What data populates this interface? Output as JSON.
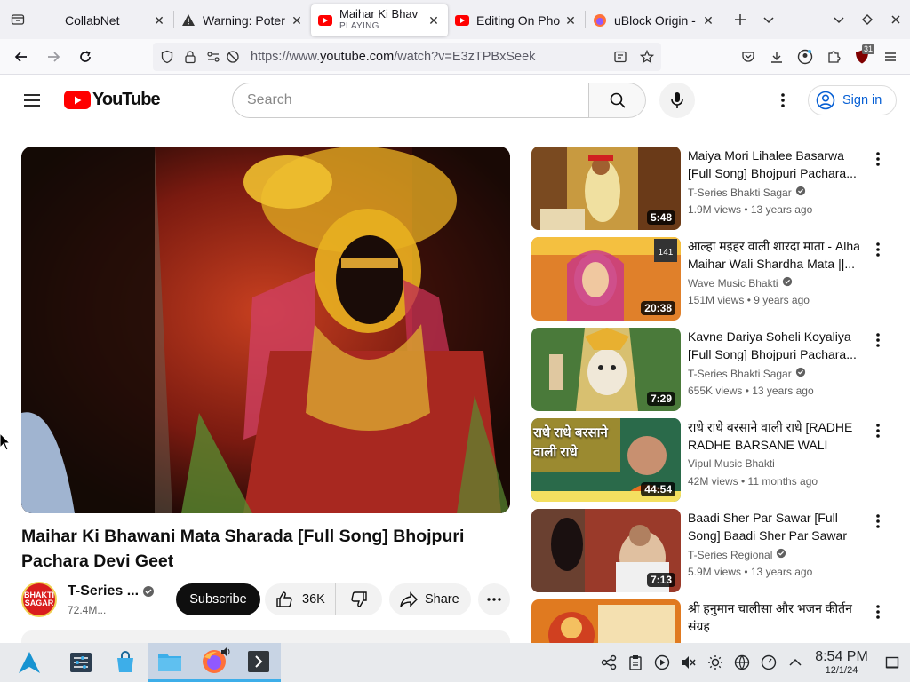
{
  "browser": {
    "tabs": [
      {
        "title": "CollabNet",
        "favicon": "blank-page-icon"
      },
      {
        "title": "Warning: Poter",
        "favicon": "warning-icon"
      },
      {
        "title": "Maihar Ki Bhav",
        "sub": "PLAYING",
        "favicon": "youtube-icon",
        "active": true
      },
      {
        "title": "Editing On Pho",
        "favicon": "youtube-icon"
      },
      {
        "title": "uBlock Origin -",
        "favicon": "firefox-icon"
      }
    ],
    "url_prefix": "https://www.",
    "url_host": "youtube.com",
    "url_path": "/watch?v=E3zTPBxSeek",
    "ublock_badge": "31"
  },
  "youtube": {
    "logo_text": "YouTube",
    "search_placeholder": "Search",
    "sign_in": "Sign in"
  },
  "video": {
    "title": "Maihar Ki Bhawani Mata Sharada [Full Song] Bhojpuri Pachara Devi Geet",
    "channel": "T-Series ...",
    "subscribers": "72.4M...",
    "subscribe_label": "Subscribe",
    "likes": "36K",
    "share_label": "Share",
    "avatar_text": "BHAKTI SAGAR"
  },
  "recommendations": [
    {
      "title": "Maiya Mori Lihalee Basarwa [Full Song] Bhojpuri Pachara...",
      "channel": "T-Series Bhakti Sagar",
      "verified": true,
      "meta": "1.9M views • 13 years ago",
      "duration": "5:48",
      "colors": [
        "#c89a40",
        "#7a4a20",
        "#e8d8b0"
      ]
    },
    {
      "title": "आल्हा मइहर वाली शारदा माता - Alha Maihar Wali Shardha Mata ||...",
      "channel": "Wave Music Bhakti",
      "verified": true,
      "meta": "151M views • 9 years ago",
      "duration": "20:38",
      "colors": [
        "#e0802a",
        "#c8348a",
        "#f4c040"
      ]
    },
    {
      "title": "Kavne Dariya Soheli Koyaliya [Full Song] Bhojpuri Pachara...",
      "channel": "T-Series Bhakti Sagar",
      "verified": true,
      "meta": "655K views • 13 years ago",
      "duration": "7:29",
      "colors": [
        "#4a7a3a",
        "#d8c070",
        "#f0e8d8"
      ]
    },
    {
      "title": "राधे राधे बरसाने वाली राधे [RADHE RADHE BARSANE WALI RADH...",
      "channel": "Vipul Music Bhakti",
      "verified": false,
      "meta": "42M views • 11 months ago",
      "duration": "44:54",
      "colors": [
        "#2a6a4a",
        "#e8a020",
        "#f4e060"
      ],
      "overlay": "राधे राधे बरसाने वाली राधे"
    },
    {
      "title": "Baadi Sher Par Sawar [Full Song] Baadi Sher Par Sawar",
      "channel": "T-Series Regional",
      "verified": true,
      "meta": "5.9M views • 13 years ago",
      "duration": "7:13",
      "colors": [
        "#9a3a2a",
        "#e0c0a0",
        "#6a4030"
      ]
    },
    {
      "title": "श्री हनुमान चालीसा और भजन कीर्तन संग्रह",
      "channel": "",
      "verified": false,
      "meta": "",
      "duration": "",
      "colors": [
        "#e07a20",
        "#d04020",
        "#f4c060"
      ]
    }
  ],
  "taskbar": {
    "time": "8:54 PM",
    "date": "12/1/24"
  }
}
